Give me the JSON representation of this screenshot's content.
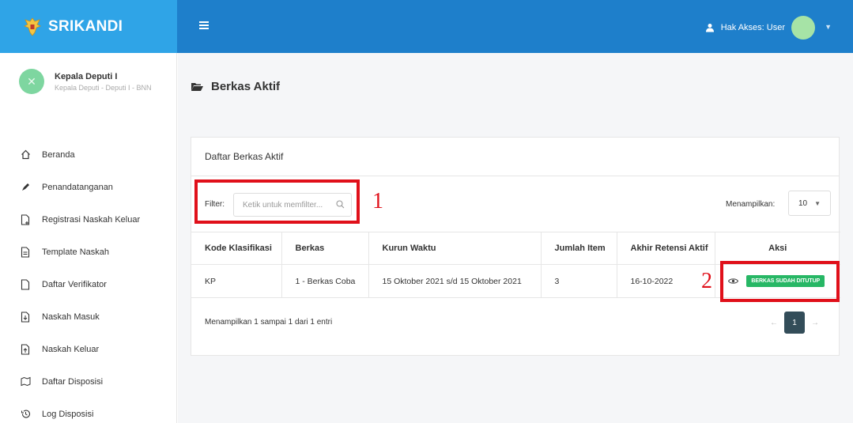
{
  "app": {
    "name": "SRIKANDI"
  },
  "topbar": {
    "hak_akses": "Hak Akses: User"
  },
  "profile": {
    "name": "Kepala Deputi I",
    "role": "Kepala Deputi - Deputi I - BNN"
  },
  "sidebar": {
    "items": [
      {
        "label": "Beranda",
        "icon": "home-icon"
      },
      {
        "label": "Penandatanganan",
        "icon": "pen-icon"
      },
      {
        "label": "Registrasi Naskah Keluar",
        "icon": "file-plus-icon"
      },
      {
        "label": "Template Naskah",
        "icon": "file-text-icon"
      },
      {
        "label": "Daftar Verifikator",
        "icon": "file-icon"
      },
      {
        "label": "Naskah Masuk",
        "icon": "file-down-icon"
      },
      {
        "label": "Naskah Keluar",
        "icon": "file-up-icon"
      },
      {
        "label": "Daftar Disposisi",
        "icon": "map-icon"
      },
      {
        "label": "Log Disposisi",
        "icon": "history-icon"
      }
    ]
  },
  "page": {
    "title": "Berkas Aktif"
  },
  "card": {
    "title": "Daftar Berkas Aktif",
    "filter_label": "Filter:",
    "filter_placeholder": "Ketik untuk memfilter...",
    "show_label": "Menampilkan:",
    "show_value": "10",
    "columns": [
      "Kode Klasifikasi",
      "Berkas",
      "Kurun Waktu",
      "Jumlah Item",
      "Akhir Retensi Aktif",
      "Aksi"
    ],
    "rows": [
      {
        "kode": "KP",
        "berkas": "1 - Berkas Coba",
        "kurun": "15 Oktober 2021 s/d 15 Oktober 2021",
        "jumlah": "3",
        "akhir": "16-10-2022",
        "badge": "BERKAS SUDAH DITUTUP"
      }
    ],
    "info": "Menampilkan 1 sampai 1 dari 1 entri",
    "pager": {
      "prev": "←",
      "page": "1",
      "next": "→"
    }
  },
  "annotations": {
    "one": "1",
    "two": "2"
  },
  "colors": {
    "brand": "#2fa4e7",
    "topbar": "#1e7fcb",
    "highlight": "#e0101a",
    "badge": "#27b765"
  }
}
